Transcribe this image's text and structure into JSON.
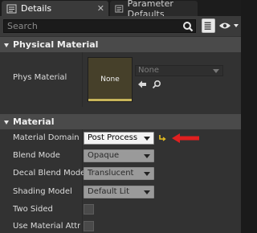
{
  "tabs": [
    {
      "label": "Details",
      "icon": "details-icon",
      "close": "✕"
    },
    {
      "label": "Parameter Defaults",
      "icon": "parameter-defaults-icon",
      "close": "✕"
    }
  ],
  "search": {
    "placeholder": "Search"
  },
  "sections": {
    "physical_material": {
      "title": "Physical Material",
      "phys_material": {
        "label": "Phys Material",
        "thumbnail_text": "None",
        "value": "None"
      }
    },
    "material": {
      "title": "Material",
      "rows": [
        {
          "label": "Material Domain",
          "value": "Post Process"
        },
        {
          "label": "Blend Mode",
          "value": "Opaque"
        },
        {
          "label": "Decal Blend Mode",
          "value": "Translucent"
        },
        {
          "label": "Shading Model",
          "value": "Default Lit"
        },
        {
          "label": "Two Sided"
        },
        {
          "label": "Use Material Attribu"
        }
      ]
    }
  },
  "colors": {
    "accent_red": "#e02020",
    "reset_yellow": "#e8c020",
    "thumbnail_edge": "#c8b55a"
  }
}
